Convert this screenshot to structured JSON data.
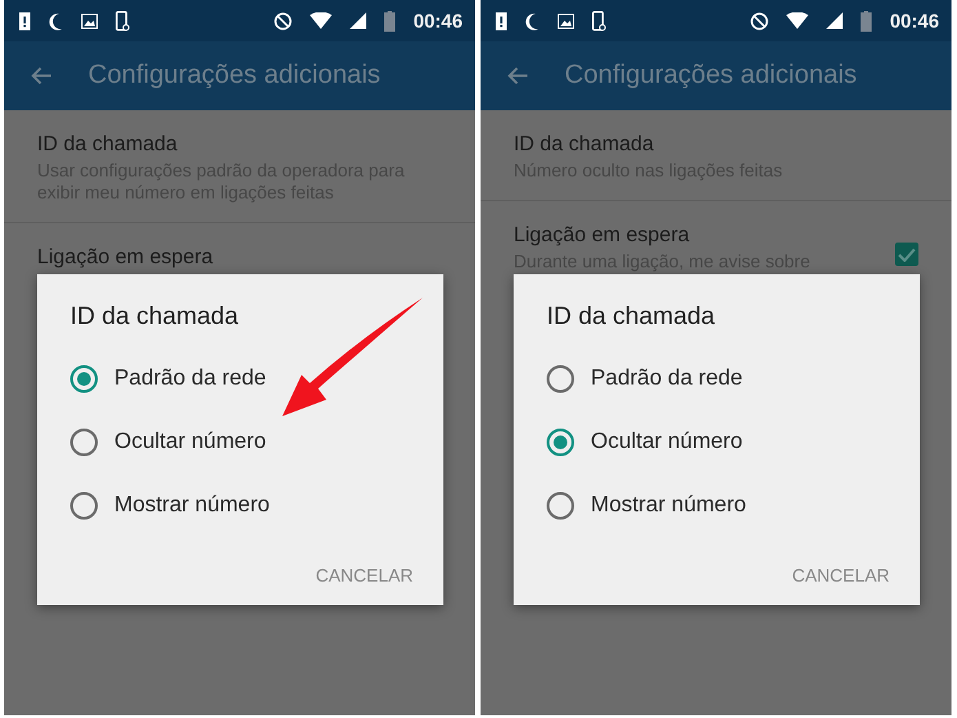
{
  "screens": [
    {
      "status_bar": {
        "time": "00:46"
      },
      "app_bar": {
        "title": "Configurações adicionais"
      },
      "settings": [
        {
          "title": "ID da chamada",
          "subtitle": "Usar configurações padrão da operadora para exibir meu número em ligações feitas"
        },
        {
          "title": "Ligação em espera"
        }
      ],
      "dialog": {
        "title": "ID da chamada",
        "options": [
          {
            "label": "Padrão da rede",
            "selected": true
          },
          {
            "label": "Ocultar número",
            "selected": false
          },
          {
            "label": "Mostrar número",
            "selected": false
          }
        ],
        "button": "CANCELAR"
      },
      "annotation_arrow": true
    },
    {
      "status_bar": {
        "time": "00:46"
      },
      "app_bar": {
        "title": "Configurações adicionais"
      },
      "settings": [
        {
          "title": "ID da chamada",
          "subtitle": "Número oculto nas ligações feitas"
        },
        {
          "title": "Ligação em espera",
          "subtitle": "Durante uma ligação, me avise sobre",
          "checked": true
        }
      ],
      "dialog": {
        "title": "ID da chamada",
        "options": [
          {
            "label": "Padrão da rede",
            "selected": false
          },
          {
            "label": "Ocultar número",
            "selected": true
          },
          {
            "label": "Mostrar número",
            "selected": false
          }
        ],
        "button": "CANCELAR"
      }
    }
  ]
}
